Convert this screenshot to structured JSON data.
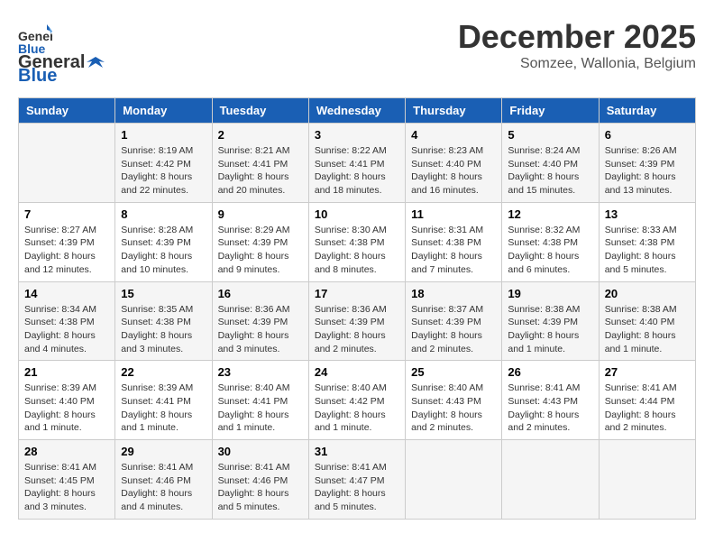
{
  "header": {
    "logo_line1": "General",
    "logo_line2": "Blue",
    "month": "December 2025",
    "location": "Somzee, Wallonia, Belgium"
  },
  "weekdays": [
    "Sunday",
    "Monday",
    "Tuesday",
    "Wednesday",
    "Thursday",
    "Friday",
    "Saturday"
  ],
  "weeks": [
    [
      {
        "day": null
      },
      {
        "day": 1,
        "sunrise": "8:19 AM",
        "sunset": "4:42 PM",
        "daylight": "8 hours and 22 minutes."
      },
      {
        "day": 2,
        "sunrise": "8:21 AM",
        "sunset": "4:41 PM",
        "daylight": "8 hours and 20 minutes."
      },
      {
        "day": 3,
        "sunrise": "8:22 AM",
        "sunset": "4:41 PM",
        "daylight": "8 hours and 18 minutes."
      },
      {
        "day": 4,
        "sunrise": "8:23 AM",
        "sunset": "4:40 PM",
        "daylight": "8 hours and 16 minutes."
      },
      {
        "day": 5,
        "sunrise": "8:24 AM",
        "sunset": "4:40 PM",
        "daylight": "8 hours and 15 minutes."
      },
      {
        "day": 6,
        "sunrise": "8:26 AM",
        "sunset": "4:39 PM",
        "daylight": "8 hours and 13 minutes."
      }
    ],
    [
      {
        "day": 7,
        "sunrise": "8:27 AM",
        "sunset": "4:39 PM",
        "daylight": "8 hours and 12 minutes."
      },
      {
        "day": 8,
        "sunrise": "8:28 AM",
        "sunset": "4:39 PM",
        "daylight": "8 hours and 10 minutes."
      },
      {
        "day": 9,
        "sunrise": "8:29 AM",
        "sunset": "4:39 PM",
        "daylight": "8 hours and 9 minutes."
      },
      {
        "day": 10,
        "sunrise": "8:30 AM",
        "sunset": "4:38 PM",
        "daylight": "8 hours and 8 minutes."
      },
      {
        "day": 11,
        "sunrise": "8:31 AM",
        "sunset": "4:38 PM",
        "daylight": "8 hours and 7 minutes."
      },
      {
        "day": 12,
        "sunrise": "8:32 AM",
        "sunset": "4:38 PM",
        "daylight": "8 hours and 6 minutes."
      },
      {
        "day": 13,
        "sunrise": "8:33 AM",
        "sunset": "4:38 PM",
        "daylight": "8 hours and 5 minutes."
      }
    ],
    [
      {
        "day": 14,
        "sunrise": "8:34 AM",
        "sunset": "4:38 PM",
        "daylight": "8 hours and 4 minutes."
      },
      {
        "day": 15,
        "sunrise": "8:35 AM",
        "sunset": "4:38 PM",
        "daylight": "8 hours and 3 minutes."
      },
      {
        "day": 16,
        "sunrise": "8:36 AM",
        "sunset": "4:39 PM",
        "daylight": "8 hours and 3 minutes."
      },
      {
        "day": 17,
        "sunrise": "8:36 AM",
        "sunset": "4:39 PM",
        "daylight": "8 hours and 2 minutes."
      },
      {
        "day": 18,
        "sunrise": "8:37 AM",
        "sunset": "4:39 PM",
        "daylight": "8 hours and 2 minutes."
      },
      {
        "day": 19,
        "sunrise": "8:38 AM",
        "sunset": "4:39 PM",
        "daylight": "8 hours and 1 minute."
      },
      {
        "day": 20,
        "sunrise": "8:38 AM",
        "sunset": "4:40 PM",
        "daylight": "8 hours and 1 minute."
      }
    ],
    [
      {
        "day": 21,
        "sunrise": "8:39 AM",
        "sunset": "4:40 PM",
        "daylight": "8 hours and 1 minute."
      },
      {
        "day": 22,
        "sunrise": "8:39 AM",
        "sunset": "4:41 PM",
        "daylight": "8 hours and 1 minute."
      },
      {
        "day": 23,
        "sunrise": "8:40 AM",
        "sunset": "4:41 PM",
        "daylight": "8 hours and 1 minute."
      },
      {
        "day": 24,
        "sunrise": "8:40 AM",
        "sunset": "4:42 PM",
        "daylight": "8 hours and 1 minute."
      },
      {
        "day": 25,
        "sunrise": "8:40 AM",
        "sunset": "4:43 PM",
        "daylight": "8 hours and 2 minutes."
      },
      {
        "day": 26,
        "sunrise": "8:41 AM",
        "sunset": "4:43 PM",
        "daylight": "8 hours and 2 minutes."
      },
      {
        "day": 27,
        "sunrise": "8:41 AM",
        "sunset": "4:44 PM",
        "daylight": "8 hours and 2 minutes."
      }
    ],
    [
      {
        "day": 28,
        "sunrise": "8:41 AM",
        "sunset": "4:45 PM",
        "daylight": "8 hours and 3 minutes."
      },
      {
        "day": 29,
        "sunrise": "8:41 AM",
        "sunset": "4:46 PM",
        "daylight": "8 hours and 4 minutes."
      },
      {
        "day": 30,
        "sunrise": "8:41 AM",
        "sunset": "4:46 PM",
        "daylight": "8 hours and 5 minutes."
      },
      {
        "day": 31,
        "sunrise": "8:41 AM",
        "sunset": "4:47 PM",
        "daylight": "8 hours and 5 minutes."
      },
      {
        "day": null
      },
      {
        "day": null
      },
      {
        "day": null
      }
    ]
  ]
}
